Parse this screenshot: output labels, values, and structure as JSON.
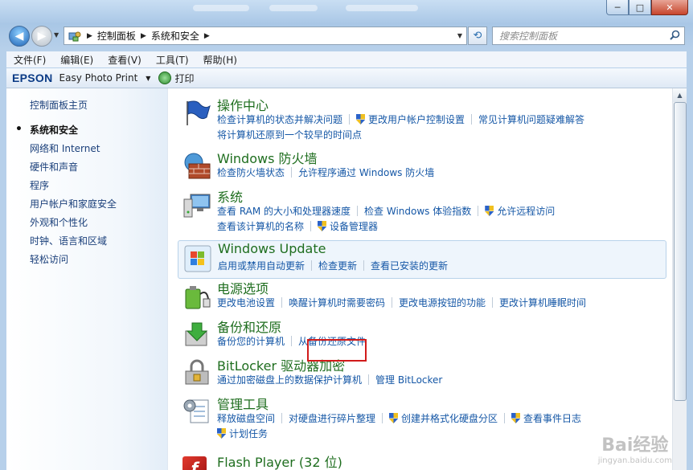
{
  "window": {
    "minimize": "─",
    "maximize": "□",
    "close": "✕"
  },
  "nav": {
    "back": "◀",
    "forward": "▶",
    "refresh": "⟲",
    "breadcrumbs": [
      "控制面板",
      "系统和安全"
    ],
    "search_placeholder": "搜索控制面板"
  },
  "menu": [
    "文件(F)",
    "编辑(E)",
    "查看(V)",
    "工具(T)",
    "帮助(H)"
  ],
  "toolbar": {
    "brand": "EPSON",
    "app": "Easy Photo Print",
    "print": "打印"
  },
  "sidebar": {
    "home": "控制面板主页",
    "items": [
      "系统和安全",
      "网络和 Internet",
      "硬件和声音",
      "程序",
      "用户帐户和家庭安全",
      "外观和个性化",
      "时钟、语言和区域",
      "轻松访问"
    ]
  },
  "categories": [
    {
      "title": "操作中心",
      "rows": [
        [
          {
            "t": "检查计算机的状态并解决问题"
          },
          {
            "t": "更改用户帐户控制设置",
            "shield": true
          },
          {
            "t": "常见计算机问题疑难解答"
          }
        ],
        [
          {
            "t": "将计算机还原到一个较早的时间点"
          }
        ]
      ]
    },
    {
      "title": "Windows 防火墙",
      "rows": [
        [
          {
            "t": "检查防火墙状态"
          },
          {
            "t": "允许程序通过 Windows 防火墙"
          }
        ]
      ]
    },
    {
      "title": "系统",
      "rows": [
        [
          {
            "t": "查看 RAM 的大小和处理器速度"
          },
          {
            "t": "检查 Windows 体验指数"
          },
          {
            "t": "允许远程访问",
            "shield": true
          }
        ],
        [
          {
            "t": "查看该计算机的名称"
          },
          {
            "t": "设备管理器",
            "shield": true
          }
        ]
      ]
    },
    {
      "title": "Windows Update",
      "rows": [
        [
          {
            "t": "启用或禁用自动更新"
          },
          {
            "t": "检查更新"
          },
          {
            "t": "查看已安装的更新"
          }
        ]
      ]
    },
    {
      "title": "电源选项",
      "rows": [
        [
          {
            "t": "更改电池设置"
          },
          {
            "t": "唤醒计算机时需要密码"
          },
          {
            "t": "更改电源按钮的功能"
          },
          {
            "t": "更改计算机睡眠时间"
          }
        ]
      ]
    },
    {
      "title": "备份和还原",
      "rows": [
        [
          {
            "t": "备份您的计算机"
          },
          {
            "t": "从备份还原文件"
          }
        ]
      ]
    },
    {
      "title": "BitLocker 驱动器加密",
      "rows": [
        [
          {
            "t": "通过加密磁盘上的数据保护计算机"
          },
          {
            "t": "管理 BitLocker"
          }
        ]
      ]
    },
    {
      "title": "管理工具",
      "rows": [
        [
          {
            "t": "释放磁盘空间"
          },
          {
            "t": "对硬盘进行碎片整理"
          },
          {
            "t": "创建并格式化硬盘分区",
            "shield": true
          },
          {
            "t": "查看事件日志",
            "shield": true
          }
        ],
        [
          {
            "t": "计划任务",
            "shield": true
          }
        ]
      ]
    },
    {
      "title": "Flash Player (32 位)",
      "rows": []
    }
  ],
  "watermark": {
    "main": "Bai经验",
    "sub": "jingyan.baidu.com"
  }
}
